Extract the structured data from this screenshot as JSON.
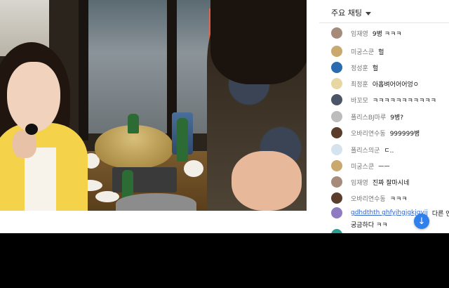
{
  "chat": {
    "header_title": "주요 채팅",
    "messages": [
      {
        "author": "임재영",
        "text": "9병 ㅋㅋㅋ",
        "avatar_color": "#a78b7a"
      },
      {
        "author": "미궁스쿤",
        "text": "헐",
        "avatar_color": "#c9a96e"
      },
      {
        "author": "정성훈",
        "text": "헐",
        "avatar_color": "#2b6cb0"
      },
      {
        "author": "최정훈",
        "text": "아홉벼어어어엉ㅇ",
        "avatar_color": "#e6d7a3"
      },
      {
        "author": "바꼬모",
        "text": "ㅋㅋㅋㅋㅋㅋㅋㅋㅋㅋㅋ",
        "avatar_color": "#4a5568"
      },
      {
        "author": "폴리스BJ마루",
        "text": "9병?",
        "avatar_color": "#bdbdbd"
      },
      {
        "author": "오바리연수동",
        "text": "999999병",
        "avatar_color": "#5a3e2b"
      },
      {
        "author": "폴리스의군",
        "text": "ㄷ..",
        "avatar_color": "#d5e3ee"
      },
      {
        "author": "미궁스쿤",
        "text": "ㅡㅡ",
        "avatar_color": "#c9a96e"
      },
      {
        "author": "임재영",
        "text": "진짜 잘마시네",
        "avatar_color": "#a78b7a"
      },
      {
        "author": "오바리연수동",
        "text": "ㅋㅋㅋ",
        "avatar_color": "#5a3e2b"
      }
    ],
    "last_message": {
      "author": "gdhdthth ghfyjhgjgkjgyjj",
      "text_line1": "다른 연",
      "text_line2": "궁금하다 ㅋㅋ",
      "avatar_color": "#8e7cc3"
    },
    "scroll_icon": "arrow-down-icon"
  }
}
